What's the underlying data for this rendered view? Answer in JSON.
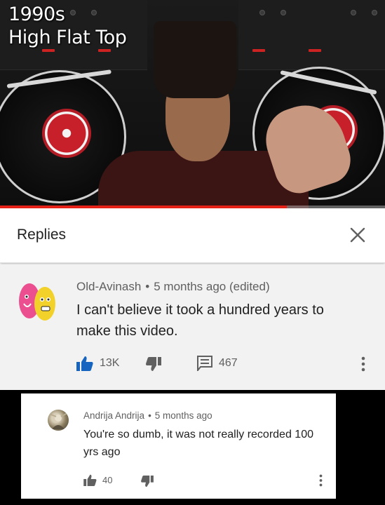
{
  "video": {
    "title_line1": "1990s",
    "title_line2": "High Flat Top",
    "progress_fraction": 0.745,
    "progress_color": "#e62117"
  },
  "replies": {
    "title": "Replies",
    "close_icon": "close-icon"
  },
  "comment": {
    "author": "Old-Avinash",
    "separator": "•",
    "time": "5 months ago (edited)",
    "text": "I can't believe it took a hundred years to make this video.",
    "likes": "13K",
    "replies_count": "467",
    "like_color": "#1565c0",
    "icons": [
      "thumbs-up-icon",
      "thumbs-down-icon",
      "comment-icon",
      "more-vert-icon"
    ]
  },
  "reply": {
    "author": "Andrija Andrija",
    "separator": "•",
    "time": "5 months ago",
    "text": "You're so dumb, it was not really recorded 100 yrs ago",
    "likes": "40",
    "icons": [
      "thumbs-up-icon",
      "thumbs-down-icon",
      "more-vert-icon"
    ]
  }
}
